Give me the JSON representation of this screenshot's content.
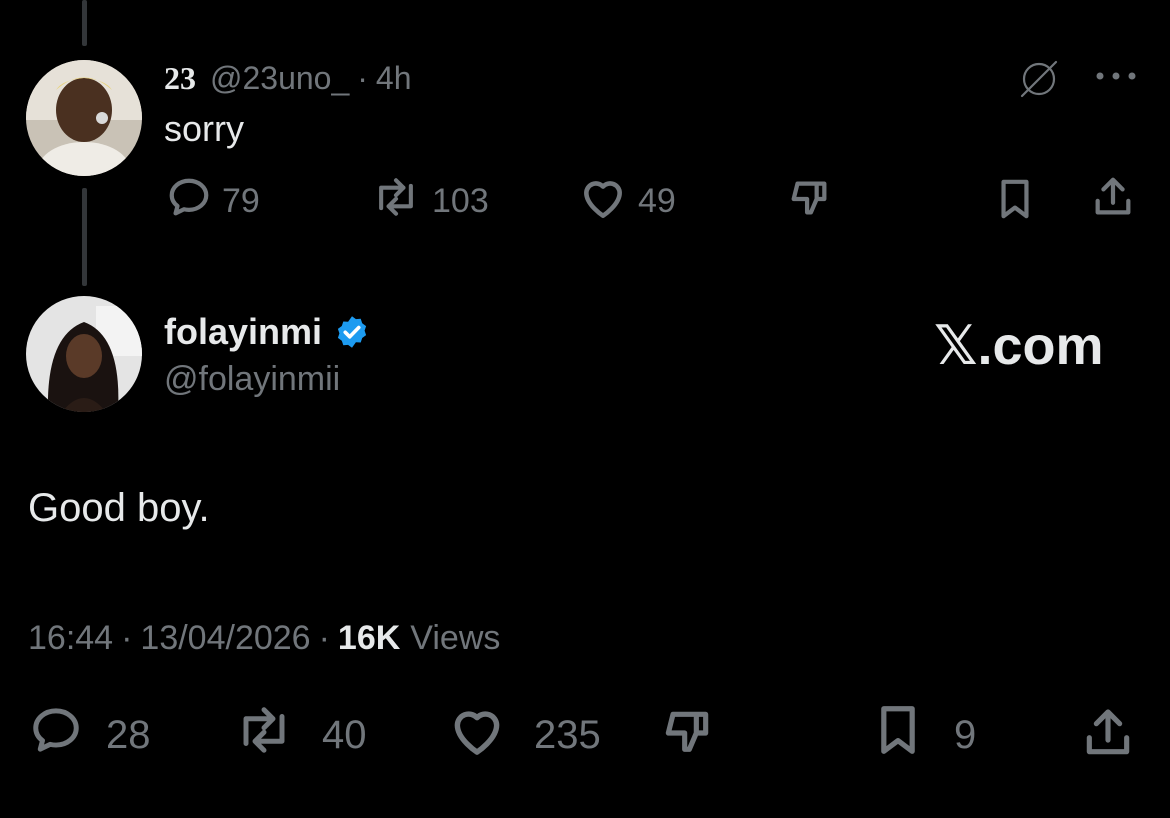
{
  "reply": {
    "display_name": "23",
    "handle": "@23uno_",
    "separator": "·",
    "time": "4h",
    "text": "sorry",
    "actions": {
      "replies": "79",
      "reposts": "103",
      "likes": "49"
    }
  },
  "main": {
    "display_name": "folayinmi",
    "handle": "@folayinmii",
    "watermark": "𝕏.com",
    "text": "Good boy.",
    "timestamp_time": "16:44",
    "timestamp_date": "13/04/2026",
    "separator": "·",
    "views_count": "16K",
    "views_label": "Views",
    "actions": {
      "replies": "28",
      "reposts": "40",
      "likes": "235",
      "bookmarks": "9"
    }
  },
  "colors": {
    "background": "#000000",
    "text": "#e7e9ea",
    "muted": "#71767b",
    "verified": "#1d9bf0"
  },
  "icons": [
    "grok-icon",
    "more-icon",
    "reply-icon",
    "repost-icon",
    "like-icon",
    "dislike-icon",
    "bookmark-icon",
    "share-icon",
    "verified-badge-icon"
  ]
}
